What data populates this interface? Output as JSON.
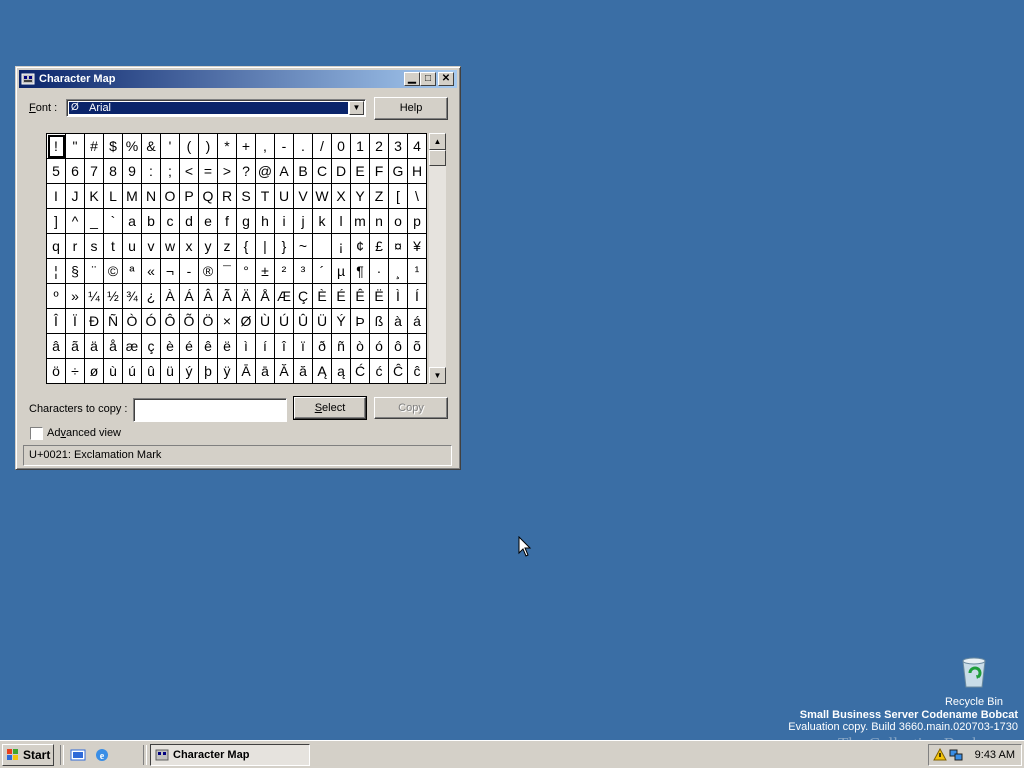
{
  "window": {
    "title": "Character Map",
    "font_label_pre": "F",
    "font_label_post": "ont :",
    "font_value": "Arial",
    "help_label": "Help",
    "copy_label": "Characters to copy :",
    "copy_value": "",
    "select_label_pre": "S",
    "select_label_post": "elect",
    "copy_button_label": "Copy",
    "advanced_label_pre": "Ad",
    "advanced_label_u": "v",
    "advanced_label_post": "anced view",
    "advanced_checked": false,
    "status": "U+0021: Exclamation Mark"
  },
  "characters": [
    "!",
    "\"",
    "#",
    "$",
    "%",
    "&",
    "'",
    "(",
    ")",
    "*",
    "+",
    ",",
    "-",
    ".",
    "/",
    "0",
    "1",
    "2",
    "3",
    "4",
    "5",
    "6",
    "7",
    "8",
    "9",
    ":",
    ";",
    "<",
    "=",
    ">",
    "?",
    "@",
    "A",
    "B",
    "C",
    "D",
    "E",
    "F",
    "G",
    "H",
    "I",
    "J",
    "K",
    "L",
    "M",
    "N",
    "O",
    "P",
    "Q",
    "R",
    "S",
    "T",
    "U",
    "V",
    "W",
    "X",
    "Y",
    "Z",
    "[",
    "\\",
    "]",
    "^",
    "_",
    "`",
    "a",
    "b",
    "c",
    "d",
    "e",
    "f",
    "g",
    "h",
    "i",
    "j",
    "k",
    "l",
    "m",
    "n",
    "o",
    "p",
    "q",
    "r",
    "s",
    "t",
    "u",
    "v",
    "w",
    "x",
    "y",
    "z",
    "{",
    "|",
    "}",
    "~",
    " ",
    "¡",
    "¢",
    "£",
    "¤",
    "¥",
    "¦",
    "§",
    "¨",
    "©",
    "ª",
    "«",
    "¬",
    "-",
    "®",
    "¯",
    "°",
    "±",
    "²",
    "³",
    "´",
    "µ",
    "¶",
    "·",
    "¸",
    "¹",
    "º",
    "»",
    "¼",
    "½",
    "¾",
    "¿",
    "À",
    "Á",
    "Â",
    "Ã",
    "Ä",
    "Å",
    "Æ",
    "Ç",
    "È",
    "É",
    "Ê",
    "Ë",
    "Ì",
    "Í",
    "Î",
    "Ï",
    "Ð",
    "Ñ",
    "Ò",
    "Ó",
    "Ô",
    "Õ",
    "Ö",
    "×",
    "Ø",
    "Ù",
    "Ú",
    "Û",
    "Ü",
    "Ý",
    "Þ",
    "ß",
    "à",
    "á",
    "â",
    "ã",
    "ä",
    "å",
    "æ",
    "ç",
    "è",
    "é",
    "ê",
    "ë",
    "ì",
    "í",
    "î",
    "ï",
    "ð",
    "ñ",
    "ò",
    "ó",
    "ô",
    "õ",
    "ö",
    "÷",
    "ø",
    "ù",
    "ú",
    "û",
    "ü",
    "ý",
    "þ",
    "ÿ",
    "Ā",
    "ā",
    "Ă",
    "ă",
    "Ą",
    "ą",
    "Ć",
    "ć",
    "Ĉ",
    "ĉ"
  ],
  "selected_index": 0,
  "desktop": {
    "recycle_bin_label": "Recycle Bin",
    "watermark_line1": "Small Business Server Codename Bobcat",
    "watermark_line2": "Evaluation copy. Build 3660.main.020703-1730",
    "brand_text": "The Collection Book"
  },
  "taskbar": {
    "start_label": "Start",
    "task_label": "Character Map",
    "clock": "9:43 AM"
  }
}
